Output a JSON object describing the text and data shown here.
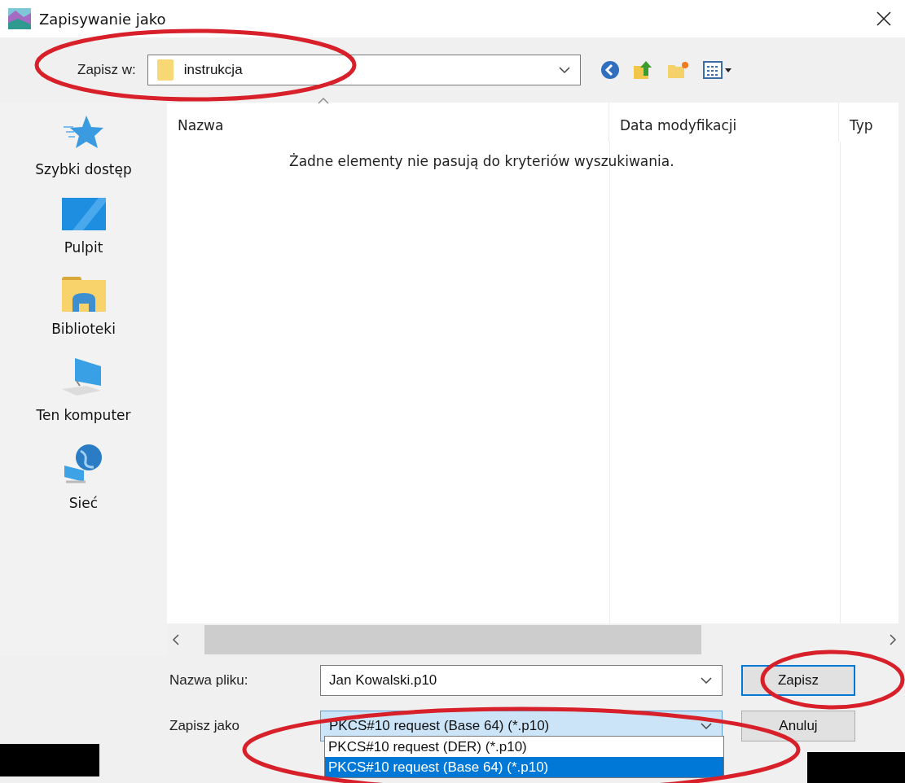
{
  "window": {
    "title": "Zapisywanie jako"
  },
  "location": {
    "label": "Zapisz w:",
    "value": "instrukcja"
  },
  "sidebar": {
    "items": [
      {
        "label": "Szybki dostęp",
        "kind": "star"
      },
      {
        "label": "Pulpit",
        "kind": "desktop"
      },
      {
        "label": "Biblioteki",
        "kind": "library"
      },
      {
        "label": "Ten komputer",
        "kind": "computer"
      },
      {
        "label": "Sieć",
        "kind": "network"
      }
    ]
  },
  "file_list": {
    "columns": [
      "Nazwa",
      "Data modyfikacji",
      "Typ"
    ],
    "empty_message": "Żadne elementy nie pasują do kryteriów wyszukiwania."
  },
  "file_name": {
    "label": "Nazwa pliku:",
    "value": "Jan Kowalski.p10"
  },
  "file_type": {
    "label": "Zapisz jako",
    "value": "PKCS#10 request (Base 64) (*.p10)",
    "expanded": true,
    "options": [
      {
        "label": "PKCS#10 request (DER) (*.p10)",
        "selected": false
      },
      {
        "label": "PKCS#10 request (Base 64) (*.p10)",
        "selected": true
      }
    ]
  },
  "buttons": [
    {
      "label": "Zapisz",
      "default": true
    },
    {
      "label": "Anuluj",
      "default": false
    }
  ],
  "annotations": [
    {
      "kind": "ellipse"
    },
    {
      "kind": "ellipse"
    },
    {
      "kind": "ellipse"
    }
  ]
}
